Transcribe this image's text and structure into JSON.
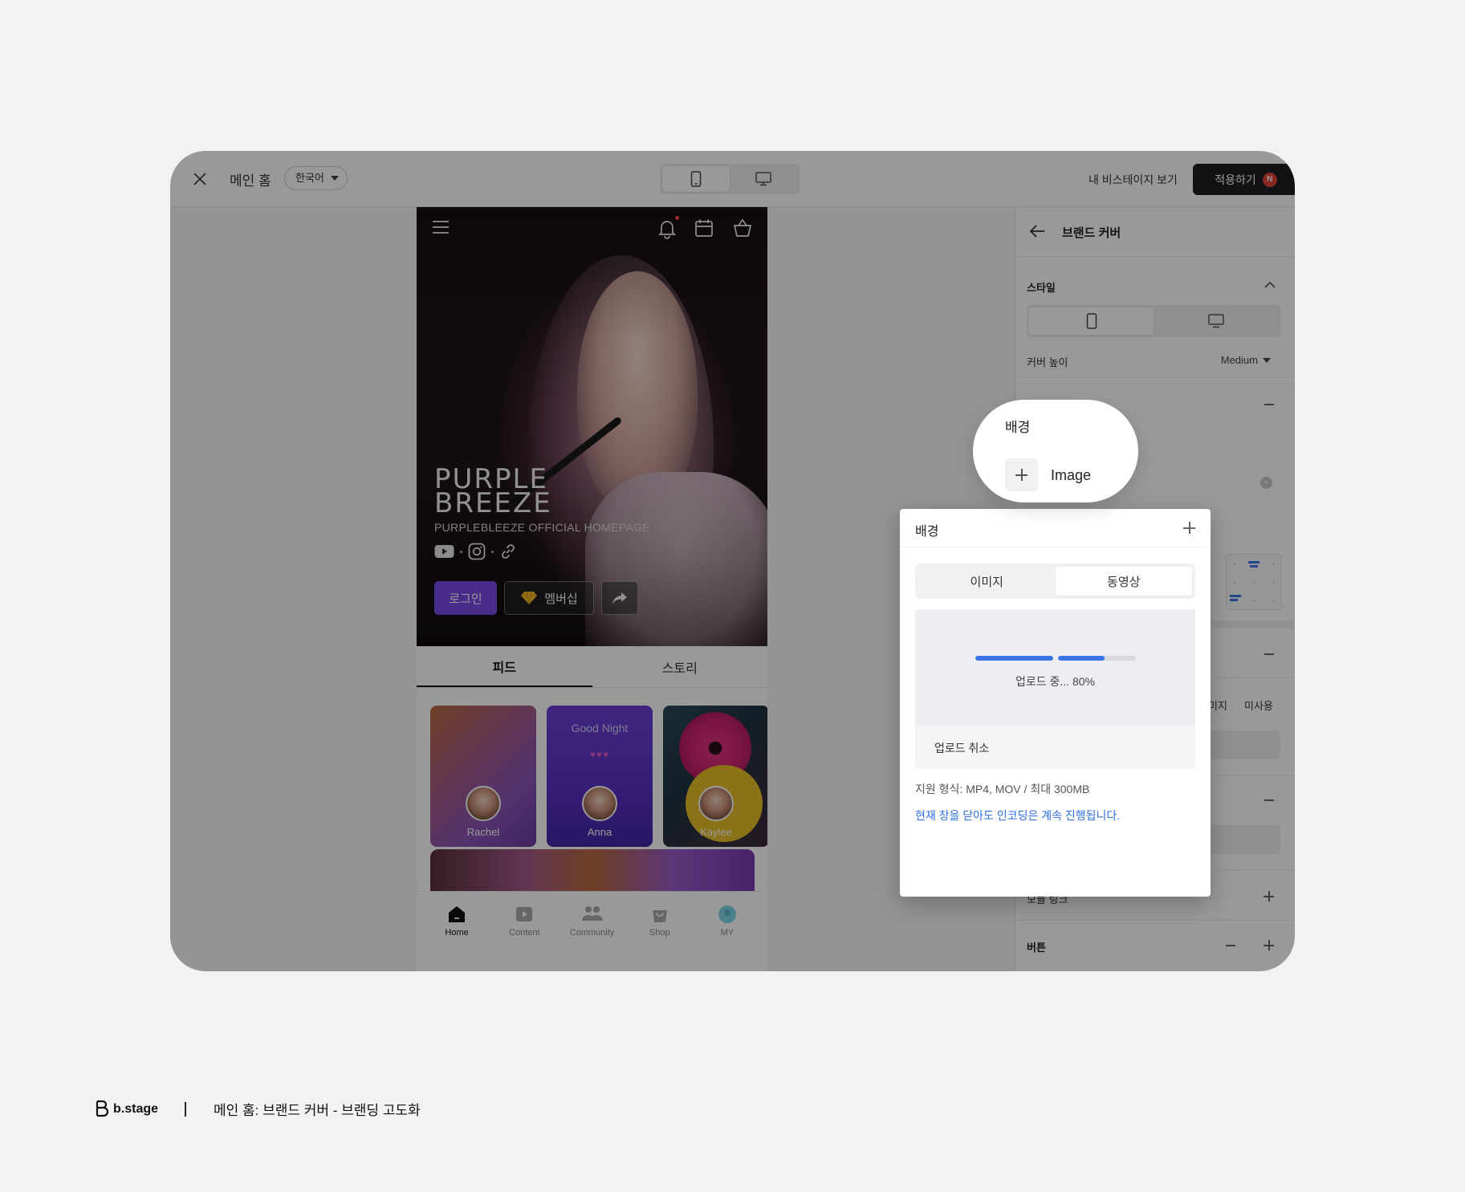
{
  "topbar": {
    "page_title": "메인 홈",
    "language": "한국어",
    "view_link": "내 비스테이지 보기",
    "apply_label": "적용하기",
    "apply_badge": "N"
  },
  "cover": {
    "title": "PURPLE\nBREEZE",
    "subtitle": "PURPLEBLEEZE  OFFICIAL HOMEPAGE",
    "login_label": "로그인",
    "membership_label": "멤버십"
  },
  "tabs": [
    {
      "label": "피드",
      "active": true
    },
    {
      "label": "스토리",
      "active": false
    }
  ],
  "stories": [
    {
      "name": "Rachel"
    },
    {
      "name": "Anna",
      "caption": "Good Night"
    },
    {
      "name": "Kaylee"
    }
  ],
  "bottom_nav": [
    {
      "label": "Home",
      "icon": "home-icon",
      "active": true
    },
    {
      "label": "Content",
      "icon": "play-icon",
      "active": false
    },
    {
      "label": "Community",
      "icon": "people-icon",
      "active": false
    },
    {
      "label": "Shop",
      "icon": "bag-icon",
      "active": false
    },
    {
      "label": "MY",
      "icon": "avatar-icon",
      "active": false
    }
  ],
  "panel": {
    "title": "브랜드 커버",
    "style_section": "스타일",
    "cover_height_label": "커버 높이",
    "cover_height_value": "Medium",
    "media_option_partial": "미지",
    "unused_option": "미사용",
    "link_label_partial": "모듈 링크",
    "button_section": "버튼"
  },
  "callout": {
    "label": "배경",
    "add_text": "Image"
  },
  "popup": {
    "title": "배경",
    "tabs": [
      {
        "label": "이미지",
        "active": false
      },
      {
        "label": "동영상",
        "active": true
      }
    ],
    "upload_status": "업로드 중...  80%",
    "upload_progress": 0.8,
    "cancel_label": "업로드 취소",
    "format_note": "지원 형식: MP4, MOV / 최대 300MB",
    "encoding_note": "현재 창을 닫아도 인코딩은 계속 진행됩니다."
  },
  "footer": {
    "logo_text": "b.stage",
    "caption": "메인 홈: 브랜드 커버 - 브랜딩 고도화"
  },
  "colors": {
    "accent": "#7a4be8",
    "progress": "#3b73e6",
    "link": "#2f6fe0",
    "badge": "#e2413a"
  }
}
